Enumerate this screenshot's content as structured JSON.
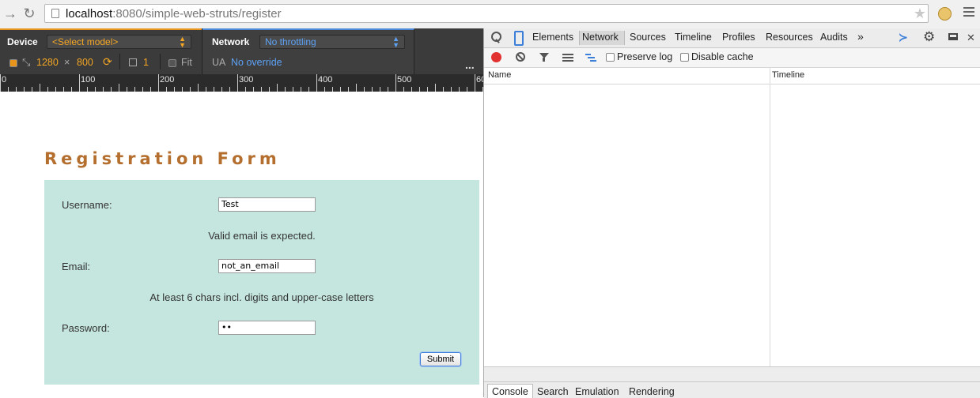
{
  "browser": {
    "url_host": "localhost",
    "url_path": ":8080/simple-web-struts/register"
  },
  "device_bar": {
    "device_label": "Device",
    "device_model": "<Select model>",
    "width": "1280",
    "times": "×",
    "height": "800",
    "scale": "1",
    "fit_label": "Fit",
    "network_label": "Network",
    "throttling": "No throttling",
    "ua_label": "UA",
    "ua_value": "No override",
    "more": "..."
  },
  "ruler": {
    "labels": [
      "0",
      "100",
      "200",
      "300",
      "400",
      "500",
      "60"
    ]
  },
  "form": {
    "title": "Registration Form",
    "username_label": "Username:",
    "username_value": "Test",
    "email_hint": "Valid email is expected.",
    "email_label": "Email:",
    "email_value": "not_an_email",
    "password_hint": "At least 6 chars incl. digits and upper-case letters",
    "password_label": "Password:",
    "password_value": "••",
    "submit_label": "Submit",
    "panel_color": "#c5e6de",
    "title_color": "#b46e2d"
  },
  "devtools": {
    "tabs": [
      "Elements",
      "Network",
      "Sources",
      "Timeline",
      "Profiles",
      "Resources",
      "Audits"
    ],
    "more_tabs": "»",
    "active_tab": "Network",
    "preserve_log": "Preserve log",
    "disable_cache": "Disable cache",
    "columns": {
      "name": "Name",
      "timeline": "Timeline"
    },
    "drawer_tabs": [
      "Console",
      "Search",
      "Emulation",
      "Rendering"
    ]
  }
}
